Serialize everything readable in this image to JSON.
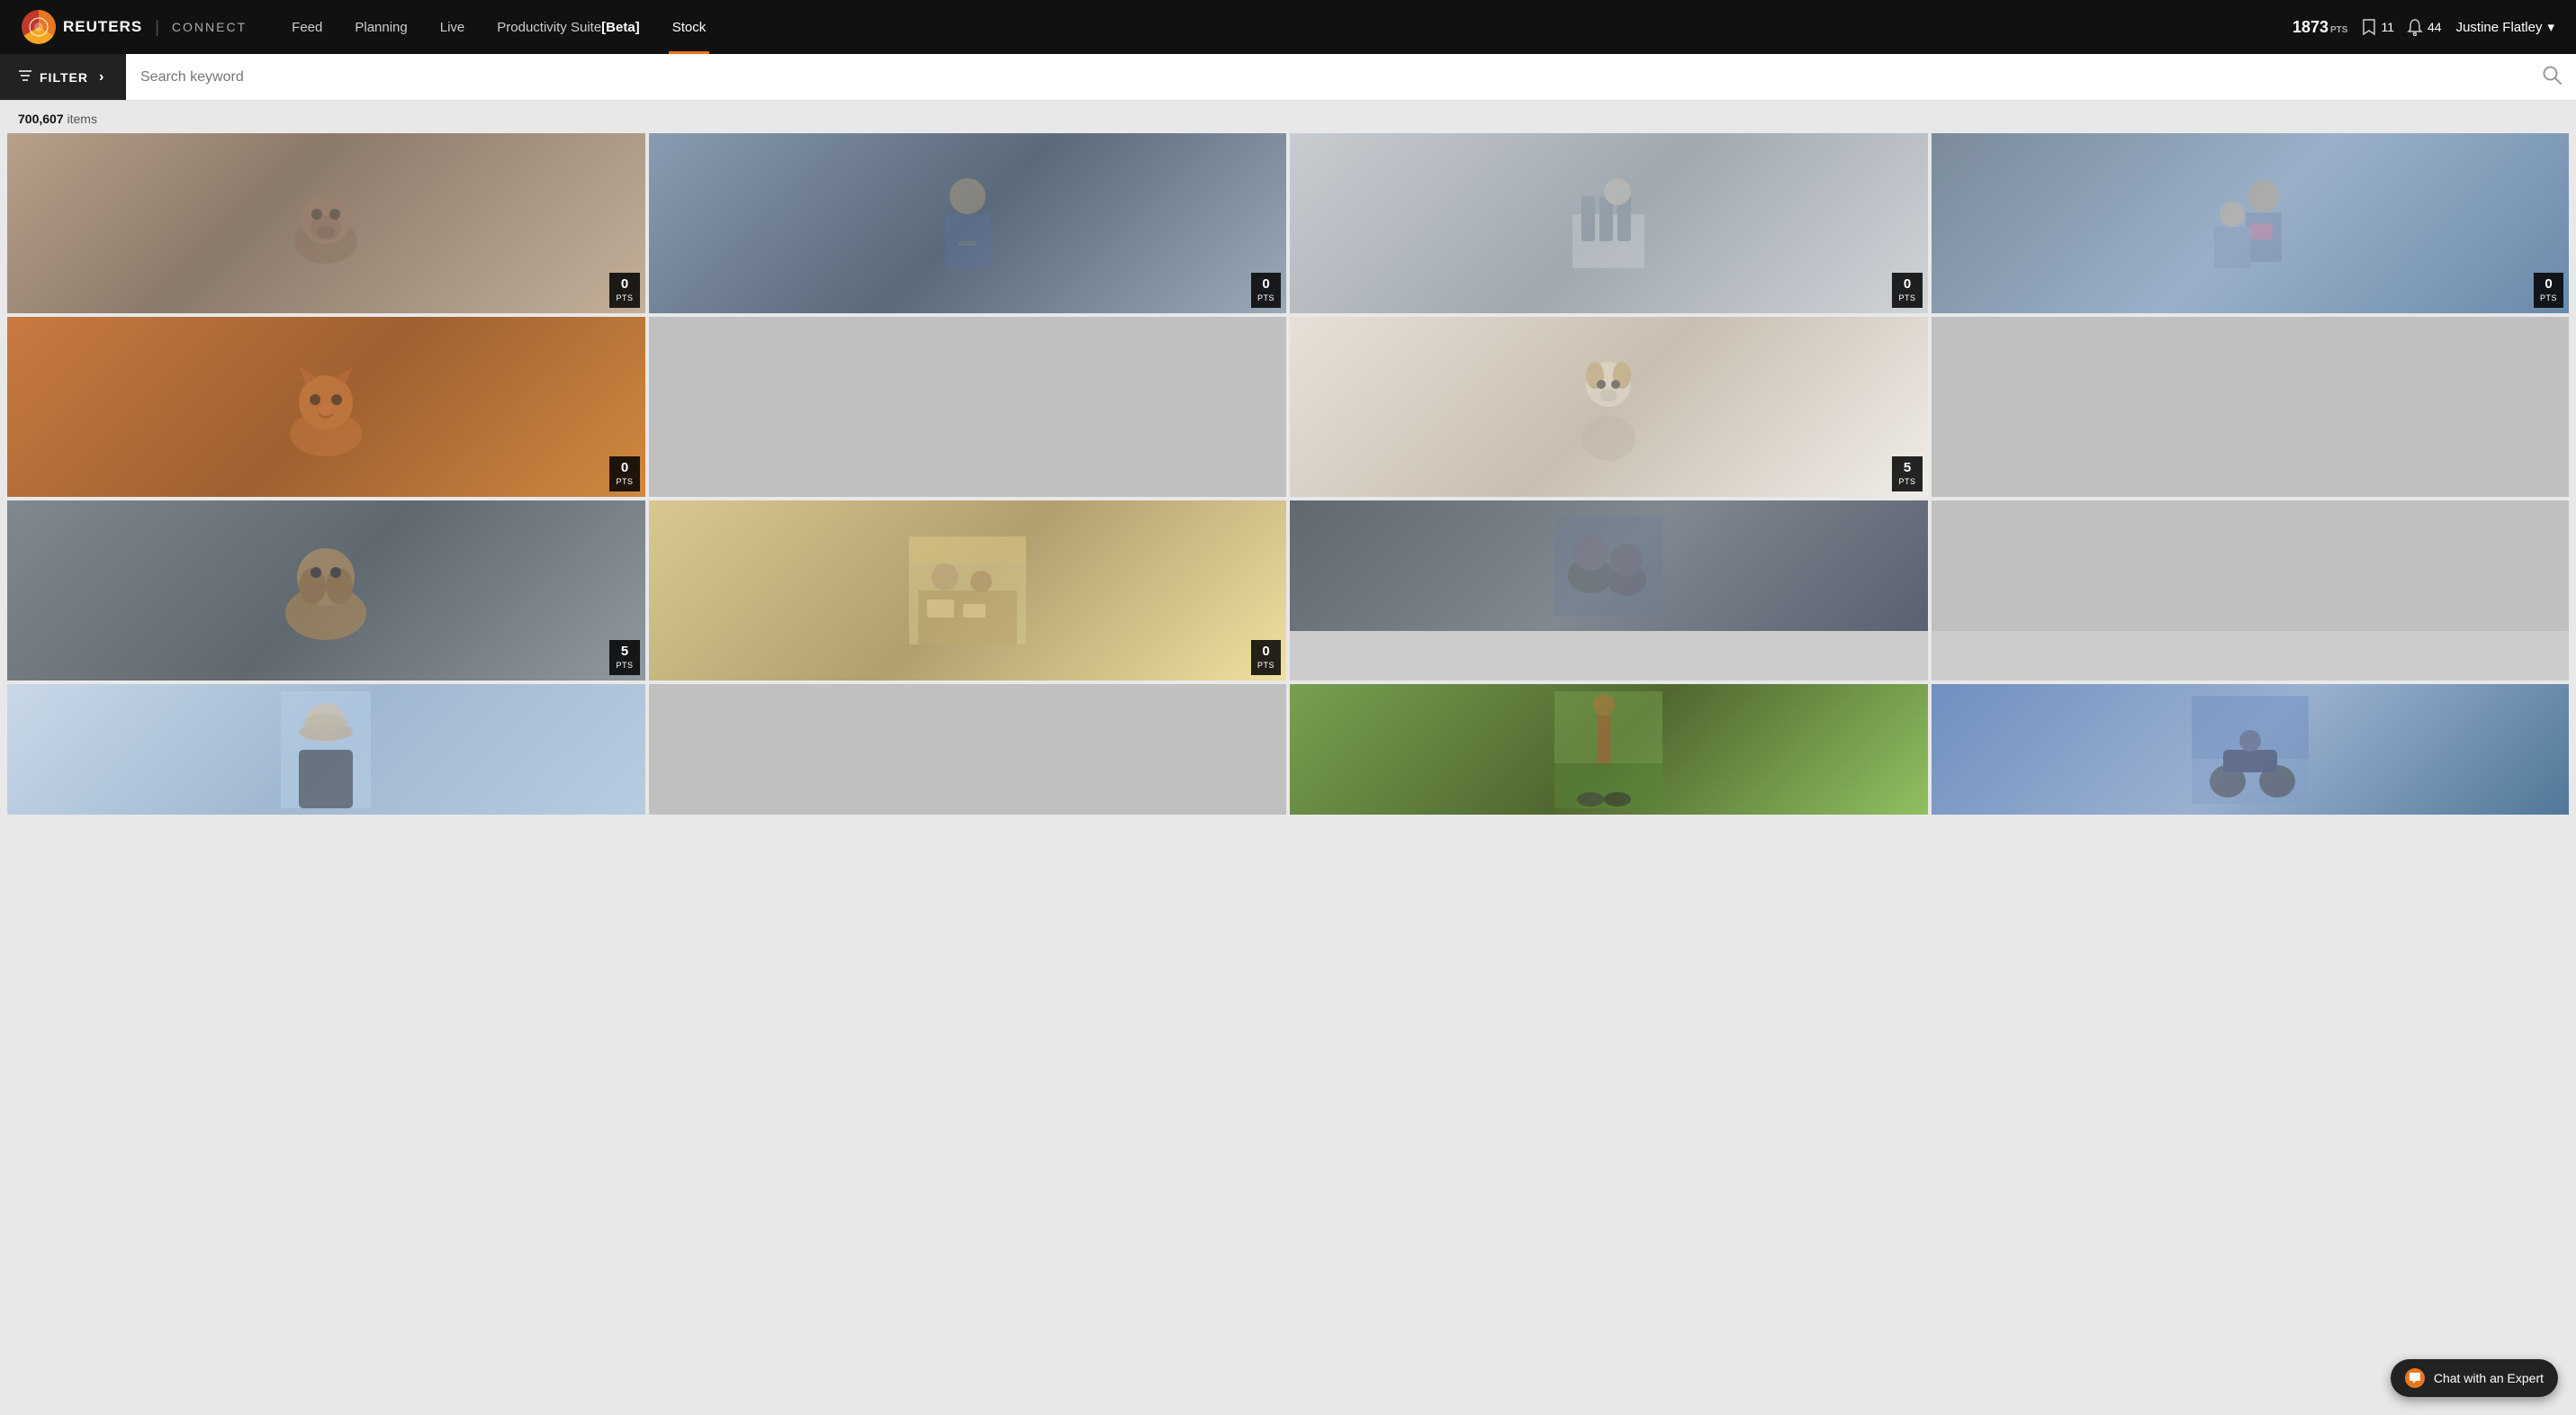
{
  "header": {
    "logo_text": "REUTERS",
    "logo_connect": "CONNECT",
    "nav_items": [
      {
        "label": "Feed",
        "active": false
      },
      {
        "label": "Planning",
        "active": false
      },
      {
        "label": "Live",
        "active": false
      },
      {
        "label": "Productivity Suite [Beta]",
        "active": false
      },
      {
        "label": "Stock",
        "active": true
      }
    ],
    "pts_number": "1873",
    "pts_label": "PTS",
    "bookmarks_count": "11",
    "notifications_count": "44",
    "user_name": "Justine Flatley"
  },
  "filter": {
    "button_label": "FILTER",
    "arrow": "›",
    "search_placeholder": "Search keyword"
  },
  "results": {
    "count": "700,607",
    "unit": "items"
  },
  "grid_items": [
    {
      "id": 1,
      "pts": "0",
      "img_class": "img-pug",
      "row": 1
    },
    {
      "id": 2,
      "pts": "0",
      "img_class": "img-teen",
      "row": 1
    },
    {
      "id": 3,
      "pts": "0",
      "img_class": "img-lab",
      "row": 1
    },
    {
      "id": 4,
      "pts": "0",
      "img_class": "img-reading",
      "row": 1
    },
    {
      "id": 5,
      "pts": "0",
      "img_class": "img-cat",
      "row": 2
    },
    {
      "id": 6,
      "pts": "",
      "img_class": "img-blank1",
      "row": 2
    },
    {
      "id": 7,
      "pts": "5",
      "img_class": "img-jackrussel",
      "row": 2
    },
    {
      "id": 8,
      "pts": "",
      "img_class": "img-blank2",
      "row": 2
    },
    {
      "id": 9,
      "pts": "5",
      "img_class": "img-retriever",
      "row": 2
    },
    {
      "id": 10,
      "pts": "0",
      "img_class": "img-bar",
      "row": 2
    },
    {
      "id": 11,
      "pts": "",
      "img_class": "img-cats2",
      "row": 3
    },
    {
      "id": 12,
      "pts": "",
      "img_class": "img-blank3",
      "row": 3
    },
    {
      "id": 13,
      "pts": "",
      "img_class": "img-woman",
      "row": 3
    },
    {
      "id": 14,
      "pts": "",
      "img_class": "img-blank4",
      "row": 3
    },
    {
      "id": 15,
      "pts": "",
      "img_class": "img-walk",
      "row": 3
    },
    {
      "id": 16,
      "pts": "",
      "img_class": "img-moto",
      "row": 3
    }
  ],
  "pts_label": "PTS",
  "chat": {
    "label": "Chat with an Expert",
    "icon": "💬"
  }
}
